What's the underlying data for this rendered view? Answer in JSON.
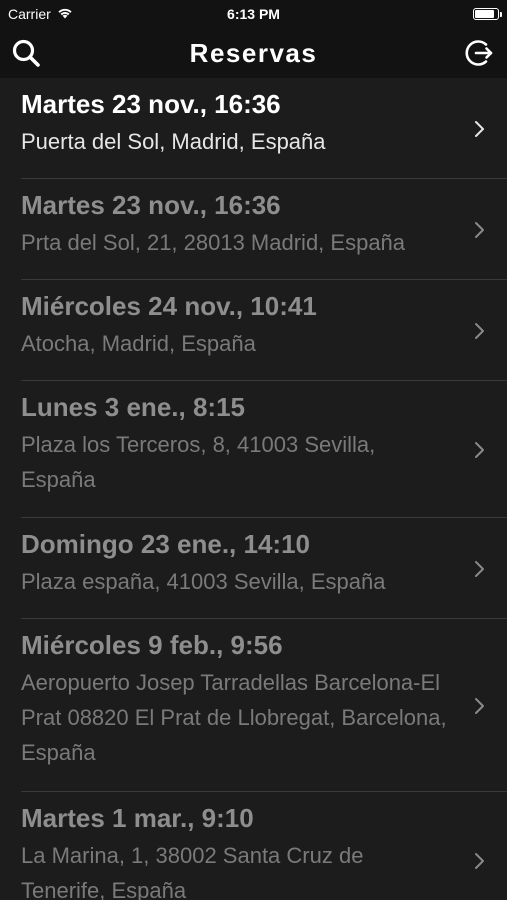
{
  "status_bar": {
    "carrier": "Carrier",
    "time": "6:13 PM"
  },
  "nav": {
    "title": "Reservas",
    "left_icon": "search-icon",
    "right_icon": "logout-icon"
  },
  "reservations": [
    {
      "date": "Martes 23 nov., 16:36",
      "address": "Puerta del Sol, Madrid, España"
    },
    {
      "date": "Martes 23 nov., 16:36",
      "address": "Prta del Sol, 21, 28013 Madrid, España"
    },
    {
      "date": "Miércoles 24 nov., 10:41",
      "address": "Atocha, Madrid, España"
    },
    {
      "date": "Lunes 3 ene., 8:15",
      "address": "Plaza los Terceros, 8, 41003 Sevilla, España"
    },
    {
      "date": "Domingo 23 ene., 14:10",
      "address": "Plaza españa, 41003 Sevilla, España"
    },
    {
      "date": "Miércoles 9 feb., 9:56",
      "address": "Aeropuerto Josep Tarradellas Barcelona-El Prat 08820 El Prat de Llobregat, Barcelona, España"
    },
    {
      "date": "Martes 1 mar., 9:10",
      "address": "La Marina, 1, 38002 Santa Cruz de Tenerife, España"
    }
  ],
  "colors": {
    "background": "#121212",
    "list_background": "#1c1c1c",
    "active_text": "#ffffff",
    "inactive_text": "#8e8e8e",
    "separator": "#3a3a3a"
  }
}
